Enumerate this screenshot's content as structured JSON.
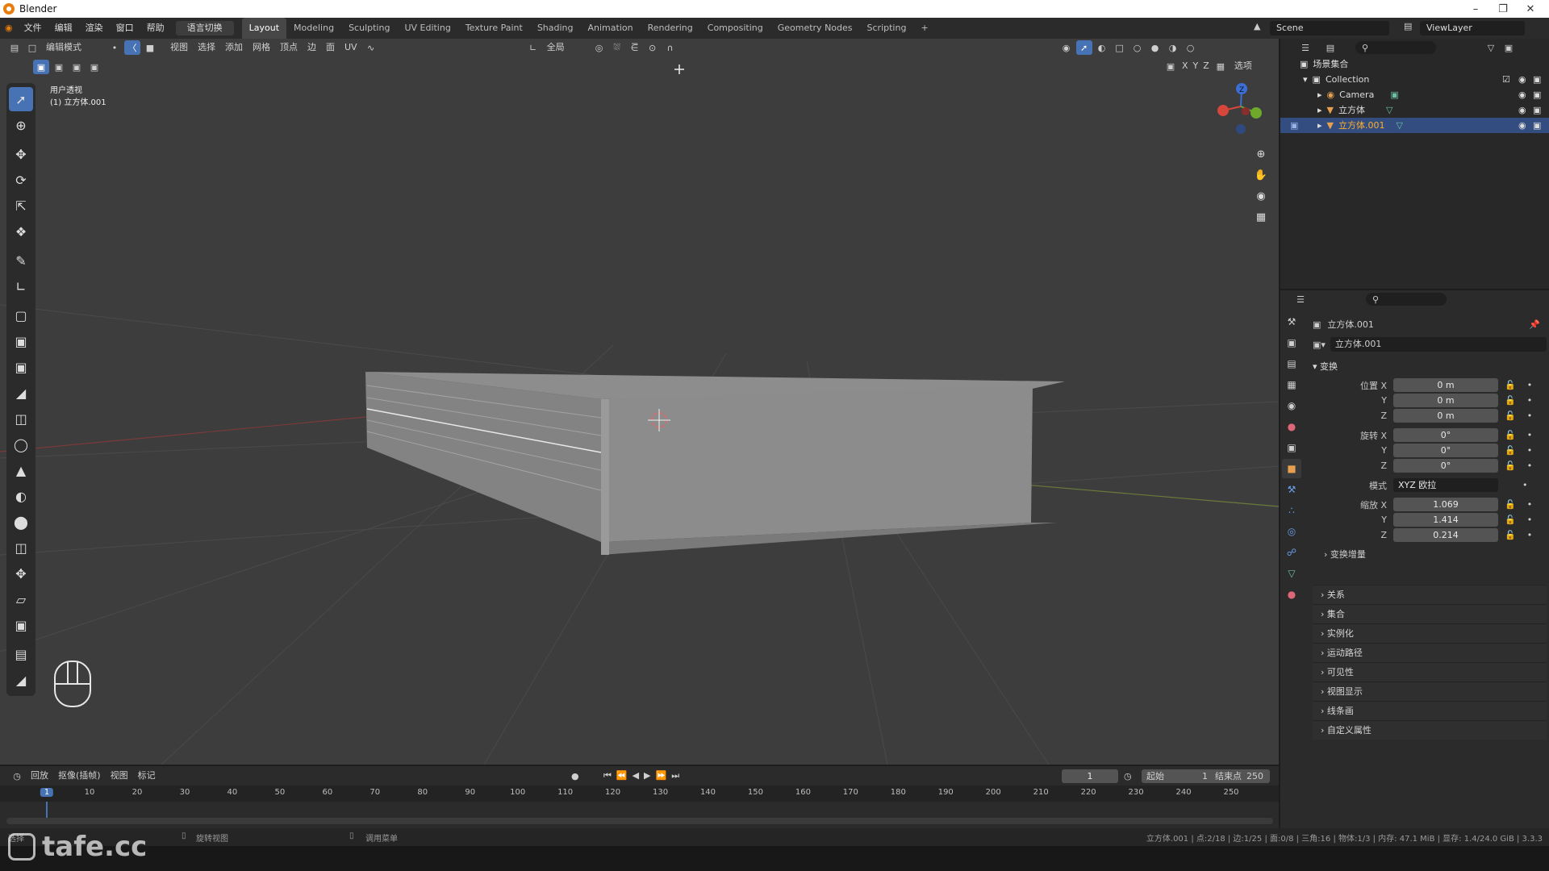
{
  "window": {
    "title": "Blender"
  },
  "menu": {
    "items": [
      "文件",
      "编辑",
      "渲染",
      "窗口",
      "帮助"
    ],
    "lang_button": "语言切换"
  },
  "workspaces": [
    "Layout",
    "Modeling",
    "Sculpting",
    "UV Editing",
    "Texture Paint",
    "Shading",
    "Animation",
    "Rendering",
    "Compositing",
    "Geometry Nodes",
    "Scripting",
    "+"
  ],
  "scene": {
    "name": "Scene",
    "view_layer": "ViewLayer"
  },
  "viewport_header": {
    "mode": "编辑模式",
    "menus": [
      "视图",
      "选择",
      "添加",
      "网格",
      "顶点",
      "边",
      "面",
      "UV"
    ],
    "transform_orientation": "全局",
    "axes": [
      "X",
      "Y",
      "Z"
    ],
    "options": "选项"
  },
  "viewport": {
    "view_name": "用户透视",
    "object_label": "(1) 立方体.001"
  },
  "outliner": {
    "root": "场景集合",
    "collection": "Collection",
    "items": [
      {
        "name": "Camera"
      },
      {
        "name": "立方体"
      },
      {
        "name": "立方体.001"
      }
    ]
  },
  "properties": {
    "object_name": "立方体.001",
    "data_name": "立方体.001",
    "panel_transform": "变换",
    "location_label": "位置 X",
    "rotation_label": "旋转 X",
    "scale_label": "缩放 X",
    "mode_label": "模式",
    "mode_value": "XYZ 欧拉",
    "location": [
      "0 m",
      "0 m",
      "0 m"
    ],
    "rotation": [
      "0°",
      "0°",
      "0°"
    ],
    "scale": [
      "1.069",
      "1.414",
      "0.214"
    ],
    "axis_y": "Y",
    "axis_z": "Z",
    "delta": "变换增量",
    "panels": [
      "关系",
      "集合",
      "实例化",
      "运动路径",
      "可见性",
      "视图显示",
      "线条画",
      "自定义属性"
    ]
  },
  "timeline": {
    "menus": [
      "回放",
      "抠像(插帧)",
      "视图",
      "标记"
    ],
    "current_frame": "1",
    "start_label": "起始",
    "start": "1",
    "end_label": "结束点",
    "end": "250",
    "ticks": [
      "1",
      "10",
      "20",
      "30",
      "40",
      "50",
      "60",
      "70",
      "80",
      "90",
      "100",
      "110",
      "120",
      "130",
      "140",
      "150",
      "160",
      "170",
      "180",
      "190",
      "200",
      "210",
      "220",
      "230",
      "240",
      "250"
    ]
  },
  "status": {
    "left": "选择",
    "mid1": "旋转视图",
    "mid2": "调用菜单",
    "right": "立方体.001 | 点:2/18 | 边:1/25 | 面:0/8 | 三角:16 | 物体:1/3 | 内存: 47.1 MiB | 显存: 1.4/24.0 GiB | 3.3.3"
  },
  "watermark": "tafe.cc"
}
